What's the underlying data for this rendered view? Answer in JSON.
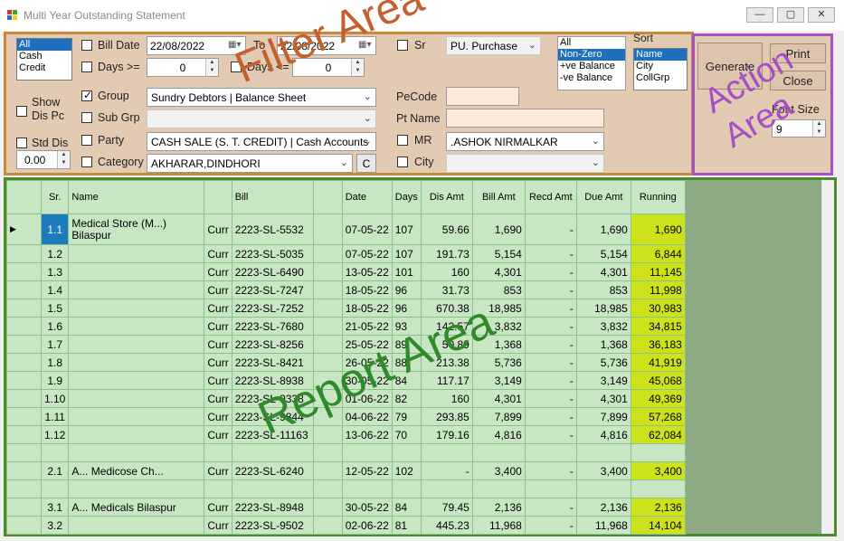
{
  "window": {
    "title": "Multi Year Outstanding Statement"
  },
  "labels": {
    "overlay_filter": "Filter Area",
    "overlay_action": "Action Area",
    "overlay_report": "Report Area"
  },
  "filter": {
    "type_list": [
      "All",
      "Cash",
      "Credit"
    ],
    "bill_date_label": "Bill Date",
    "bill_date_from": "22/08/2022",
    "to_label": "To",
    "bill_date_to": "22/08/2022",
    "days_gte_label": "Days >=",
    "days_gte_value": "0",
    "days_lte_label": "Days <=",
    "days_lte_value": "0",
    "sr_label": "Sr",
    "sr_value": "PU. Purchase",
    "balance_list": [
      "All",
      "Non-Zero",
      "+ve Balance",
      "-ve Balance"
    ],
    "sort_label": "Sort",
    "sort_list": [
      "Name",
      "City",
      "CollGrp"
    ],
    "show_dis_pc_label": "Show Dis Pc",
    "std_dis_label": "Std Dis",
    "std_dis_value": "0.00",
    "group_label": "Group",
    "group_value": "Sundry Debtors       | Balance Sheet",
    "subgrp_label": "Sub Grp",
    "pecode_label": "PeCode",
    "ptname_label": "Pt Name",
    "party_label": "Party",
    "party_value": "CASH SALE (S. T. CREDIT)  | Cash Accounts",
    "mr_label": "MR",
    "mr_value": ".ASHOK NIRMALKAR",
    "category_label": "Category",
    "category_value": "AKHARAR,DINDHORI",
    "c_button": "C",
    "city_label": "City"
  },
  "actions": {
    "generate": "Generate",
    "print": "Print",
    "close": "Close",
    "font_size_label": "Font Size",
    "font_size_value": "9"
  },
  "report": {
    "columns": [
      "Sr.",
      "Name",
      "",
      "Bill",
      "",
      "Date",
      "Days",
      "Dis Amt",
      "Bill Amt",
      "Recd Amt",
      "Due Amt",
      "Running"
    ],
    "rows": [
      {
        "sr": "1.1",
        "name": "Medical Store (M...) Bilaspur",
        "curr": "Curr",
        "bill": "2223-SL-5532",
        "date": "07-05-22",
        "days": "107",
        "dis": "59.66",
        "billamt": "1,690",
        "recd": "-",
        "due": "1,690",
        "run": "1,690"
      },
      {
        "sr": "1.2",
        "name": "",
        "curr": "Curr",
        "bill": "2223-SL-5035",
        "date": "07-05-22",
        "days": "107",
        "dis": "191.73",
        "billamt": "5,154",
        "recd": "-",
        "due": "5,154",
        "run": "6,844"
      },
      {
        "sr": "1.3",
        "name": "",
        "curr": "Curr",
        "bill": "2223-SL-6490",
        "date": "13-05-22",
        "days": "101",
        "dis": "160",
        "billamt": "4,301",
        "recd": "-",
        "due": "4,301",
        "run": "11,145"
      },
      {
        "sr": "1.4",
        "name": "",
        "curr": "Curr",
        "bill": "2223-SL-7247",
        "date": "18-05-22",
        "days": "96",
        "dis": "31.73",
        "billamt": "853",
        "recd": "-",
        "due": "853",
        "run": "11,998"
      },
      {
        "sr": "1.5",
        "name": "",
        "curr": "Curr",
        "bill": "2223-SL-7252",
        "date": "18-05-22",
        "days": "96",
        "dis": "670.38",
        "billamt": "18,985",
        "recd": "-",
        "due": "18,985",
        "run": "30,983"
      },
      {
        "sr": "1.6",
        "name": "",
        "curr": "Curr",
        "bill": "2223-SL-7680",
        "date": "21-05-22",
        "days": "93",
        "dis": "142.57",
        "billamt": "3,832",
        "recd": "-",
        "due": "3,832",
        "run": "34,815"
      },
      {
        "sr": "1.7",
        "name": "",
        "curr": "Curr",
        "bill": "2223-SL-8256",
        "date": "25-05-22",
        "days": "89",
        "dis": "50.89",
        "billamt": "1,368",
        "recd": "-",
        "due": "1,368",
        "run": "36,183"
      },
      {
        "sr": "1.8",
        "name": "",
        "curr": "Curr",
        "bill": "2223-SL-8421",
        "date": "26-05-22",
        "days": "88",
        "dis": "213.38",
        "billamt": "5,736",
        "recd": "-",
        "due": "5,736",
        "run": "41,919"
      },
      {
        "sr": "1.9",
        "name": "",
        "curr": "Curr",
        "bill": "2223-SL-8938",
        "date": "30-05-22",
        "days": "84",
        "dis": "117.17",
        "billamt": "3,149",
        "recd": "-",
        "due": "3,149",
        "run": "45,068"
      },
      {
        "sr": "1.10",
        "name": "",
        "curr": "Curr",
        "bill": "2223-SL-9338",
        "date": "01-06-22",
        "days": "82",
        "dis": "160",
        "billamt": "4,301",
        "recd": "-",
        "due": "4,301",
        "run": "49,369"
      },
      {
        "sr": "1.11",
        "name": "",
        "curr": "Curr",
        "bill": "2223-SL-9844",
        "date": "04-06-22",
        "days": "79",
        "dis": "293.85",
        "billamt": "7,899",
        "recd": "-",
        "due": "7,899",
        "run": "57,268"
      },
      {
        "sr": "1.12",
        "name": "",
        "curr": "Curr",
        "bill": "2223-SL-11163",
        "date": "13-06-22",
        "days": "70",
        "dis": "179.16",
        "billamt": "4,816",
        "recd": "-",
        "due": "4,816",
        "run": "62,084"
      },
      {
        "sr": "",
        "name": "",
        "curr": "",
        "bill": "",
        "date": "",
        "days": "",
        "dis": "",
        "billamt": "",
        "recd": "",
        "due": "",
        "run": ""
      },
      {
        "sr": "2.1",
        "name": "A... Medicose Ch...",
        "curr": "Curr",
        "bill": "2223-SL-6240",
        "date": "12-05-22",
        "days": "102",
        "dis": "-",
        "billamt": "3,400",
        "recd": "-",
        "due": "3,400",
        "run": "3,400"
      },
      {
        "sr": "",
        "name": "",
        "curr": "",
        "bill": "",
        "date": "",
        "days": "",
        "dis": "",
        "billamt": "",
        "recd": "",
        "due": "",
        "run": ""
      },
      {
        "sr": "3.1",
        "name": "A... Medicals Bilaspur",
        "curr": "Curr",
        "bill": "2223-SL-8948",
        "date": "30-05-22",
        "days": "84",
        "dis": "79.45",
        "billamt": "2,136",
        "recd": "-",
        "due": "2,136",
        "run": "2,136"
      },
      {
        "sr": "3.2",
        "name": "",
        "curr": "Curr",
        "bill": "2223-SL-9502",
        "date": "02-06-22",
        "days": "81",
        "dis": "445.23",
        "billamt": "11,968",
        "recd": "-",
        "due": "11,968",
        "run": "14,104"
      }
    ]
  }
}
